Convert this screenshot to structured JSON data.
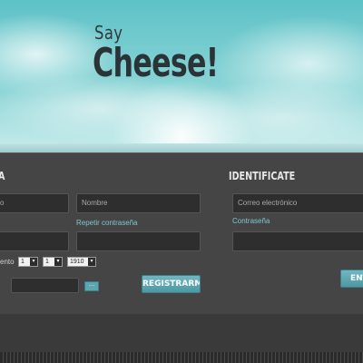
{
  "hero": {
    "say": "Say",
    "title": "Cheese!"
  },
  "register": {
    "title": "A",
    "surname_placeholder": "o",
    "name_placeholder": "Nombre",
    "repeat_password_label": "Repetir contraseña",
    "birth_label": "ento",
    "day": "1",
    "month": "1",
    "year": "1910",
    "submit": "REGISTRARME"
  },
  "login": {
    "title": "IDENTIFICATE",
    "email_placeholder": "Correo electrónico",
    "password_label": "Contraseña",
    "submit": "ENT"
  }
}
